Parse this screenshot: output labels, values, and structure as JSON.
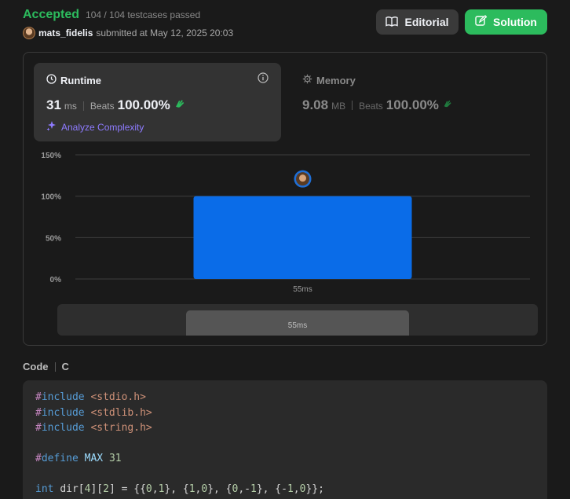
{
  "header": {
    "status": "Accepted",
    "testcases": "104 / 104 testcases passed",
    "username": "mats_fidelis",
    "submitted_text": "submitted at May 12, 2025 20:03",
    "editorial_label": "Editorial",
    "solution_label": "Solution"
  },
  "runtime": {
    "title": "Runtime",
    "value": "31",
    "unit": "ms",
    "beats_label": "Beats",
    "beats": "100.00%",
    "analyze_label": "Analyze Complexity"
  },
  "memory": {
    "title": "Memory",
    "value": "9.08",
    "unit": "MB",
    "beats_label": "Beats",
    "beats": "100.00%"
  },
  "chart_data": {
    "type": "bar",
    "categories": [
      "55ms"
    ],
    "values": [
      100
    ],
    "ylim": [
      0,
      150
    ],
    "yticks": [
      "0%",
      "50%",
      "100%",
      "150%"
    ],
    "ytick_values": [
      0,
      50,
      100,
      150
    ],
    "grid": true
  },
  "minimap": {
    "label": "55ms"
  },
  "code": {
    "label": "Code",
    "language": "C"
  },
  "colors": {
    "accepted": "#2cbb5d",
    "bar": "#0a6ce8",
    "solution_button": "#2cbb5d",
    "analyze": "#8e7bff"
  }
}
